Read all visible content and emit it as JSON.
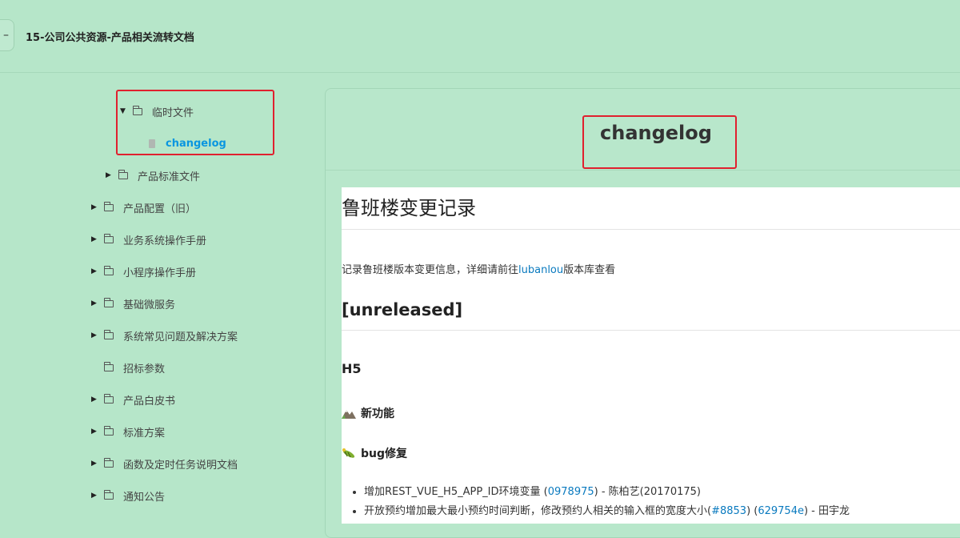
{
  "header": {
    "back_label": "–",
    "title": "15-公司公共资源-产品相关流转文档"
  },
  "sidebar": {
    "items": [
      {
        "label": "临时文件",
        "arrow": "▼"
      },
      {
        "label": "changelog"
      },
      {
        "label": "产品标准文件",
        "arrow": "▶"
      },
      {
        "label": "产品配置（旧）",
        "arrow": "▶"
      },
      {
        "label": "业务系统操作手册",
        "arrow": "▶"
      },
      {
        "label": "小程序操作手册",
        "arrow": "▶"
      },
      {
        "label": "基础微服务",
        "arrow": "▶"
      },
      {
        "label": "系统常见问题及解决方案",
        "arrow": "▶"
      },
      {
        "label": "招标参数"
      },
      {
        "label": "产品白皮书",
        "arrow": "▶"
      },
      {
        "label": "标准方案",
        "arrow": "▶"
      },
      {
        "label": "函数及定时任务说明文档",
        "arrow": "▶"
      },
      {
        "label": "通知公告",
        "arrow": "▶"
      }
    ]
  },
  "document": {
    "title": "changelog",
    "h1": "鲁班楼变更记录",
    "intro_before": "记录鲁班楼版本变更信息，详细请前往",
    "intro_link": "lubanlou",
    "intro_after": "版本库查看",
    "h2": "[unreleased]",
    "h3": "H5",
    "section_features": "新功能",
    "section_bugfix": "bug修复",
    "changes": [
      {
        "before": "增加REST_VUE_H5_APP_ID环境变量 (",
        "link": "0978975",
        "after": ") - 陈柏艺(20170175)"
      },
      {
        "before": "开放预约增加最大最小预约时间判断，修改预约人相关的输入框的宽度大小(",
        "link": "#8853",
        "middle": ") (",
        "link2": "629754e",
        "after": ") - 田宇龙"
      }
    ]
  },
  "colors": {
    "background": "#b6e6c9",
    "active_link": "#0a96e0",
    "link": "#0a7abf",
    "highlight_box": "#e0202e"
  }
}
